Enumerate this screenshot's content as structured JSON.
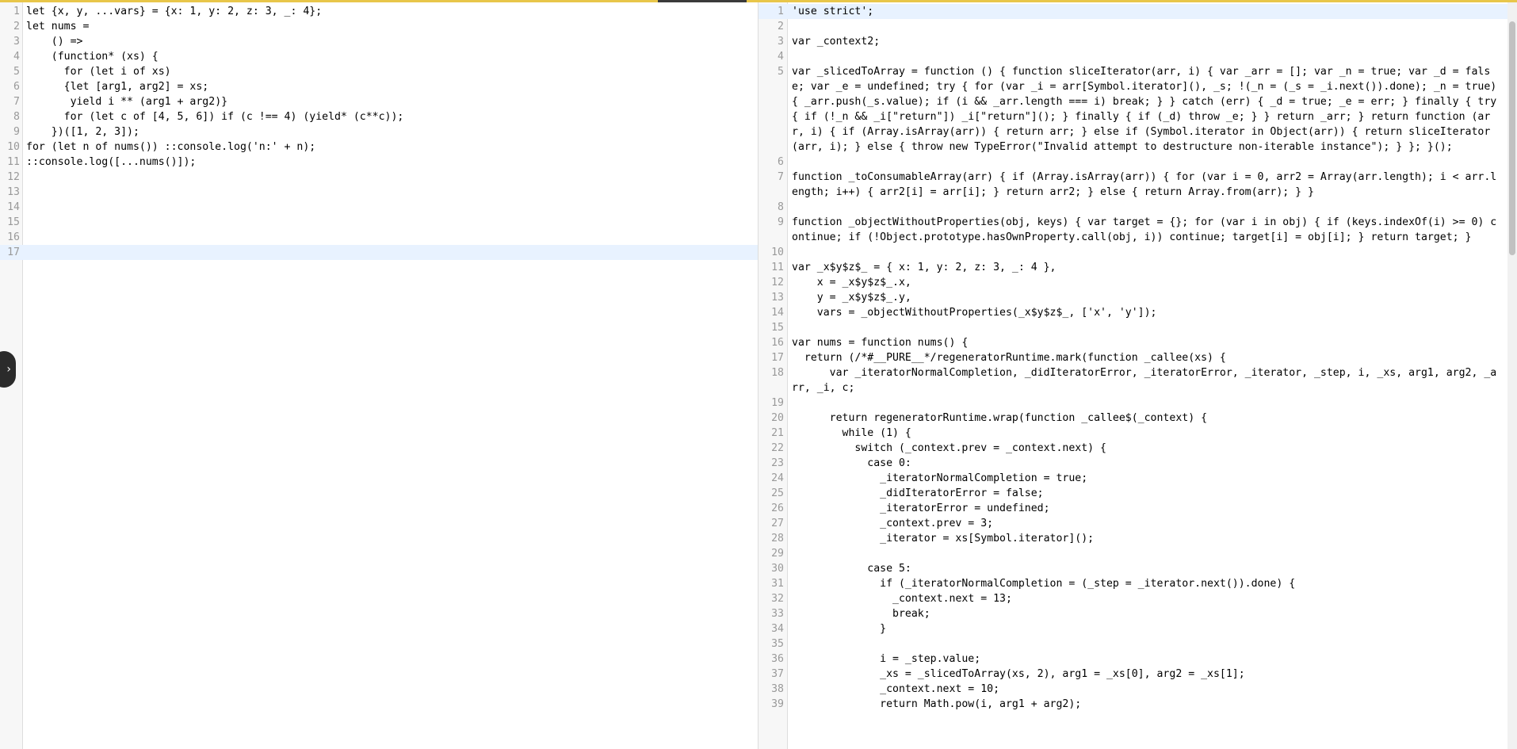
{
  "toggle": {
    "icon": "›"
  },
  "left_editor": {
    "active_line": 17,
    "lines": [
      "let {x, y, ...vars} = {x: 1, y: 2, z: 3, _: 4};",
      "let nums =",
      "    () =>",
      "    (function* (xs) {",
      "      for (let i of xs)",
      "      {let [arg1, arg2] = xs;",
      "       yield i ** (arg1 + arg2)}",
      "      for (let c of [4, 5, 6]) if (c !== 4) (yield* (c**c));",
      "    })([1, 2, 3]);",
      "for (let n of nums()) ::console.log('n:' + n);",
      "::console.log([...nums()]);",
      "",
      "",
      "",
      "",
      "",
      ""
    ]
  },
  "right_editor": {
    "active_line": 1,
    "lines": [
      "'use strict';",
      "",
      "var _context2;",
      "",
      "var _slicedToArray = function () { function sliceIterator(arr, i) { var _arr = []; var _n = true; var _d = false; var _e = undefined; try { for (var _i = arr[Symbol.iterator](), _s; !(_n = (_s = _i.next()).done); _n = true) { _arr.push(_s.value); if (i && _arr.length === i) break; } } catch (err) { _d = true; _e = err; } finally { try { if (!_n && _i[\"return\"]) _i[\"return\"](); } finally { if (_d) throw _e; } } return _arr; } return function (arr, i) { if (Array.isArray(arr)) { return arr; } else if (Symbol.iterator in Object(arr)) { return sliceIterator(arr, i); } else { throw new TypeError(\"Invalid attempt to destructure non-iterable instance\"); } }; }();",
      "",
      "function _toConsumableArray(arr) { if (Array.isArray(arr)) { for (var i = 0, arr2 = Array(arr.length); i < arr.length; i++) { arr2[i] = arr[i]; } return arr2; } else { return Array.from(arr); } }",
      "",
      "function _objectWithoutProperties(obj, keys) { var target = {}; for (var i in obj) { if (keys.indexOf(i) >= 0) continue; if (!Object.prototype.hasOwnProperty.call(obj, i)) continue; target[i] = obj[i]; } return target; }",
      "",
      "var _x$y$z$_ = { x: 1, y: 2, z: 3, _: 4 },",
      "    x = _x$y$z$_.x,",
      "    y = _x$y$z$_.y,",
      "    vars = _objectWithoutProperties(_x$y$z$_, ['x', 'y']);",
      "",
      "var nums = function nums() {",
      "  return (/*#__PURE__*/regeneratorRuntime.mark(function _callee(xs) {",
      "      var _iteratorNormalCompletion, _didIteratorError, _iteratorError, _iterator, _step, i, _xs, arg1, arg2, _arr, _i, c;",
      "",
      "      return regeneratorRuntime.wrap(function _callee$(_context) {",
      "        while (1) {",
      "          switch (_context.prev = _context.next) {",
      "            case 0:",
      "              _iteratorNormalCompletion = true;",
      "              _didIteratorError = false;",
      "              _iteratorError = undefined;",
      "              _context.prev = 3;",
      "              _iterator = xs[Symbol.iterator]();",
      "",
      "            case 5:",
      "              if (_iteratorNormalCompletion = (_step = _iterator.next()).done) {",
      "                _context.next = 13;",
      "                break;",
      "              }",
      "",
      "              i = _step.value;",
      "              _xs = _slicedToArray(xs, 2), arg1 = _xs[0], arg2 = _xs[1];",
      "              _context.next = 10;",
      "              return Math.pow(i, arg1 + arg2);"
    ]
  }
}
